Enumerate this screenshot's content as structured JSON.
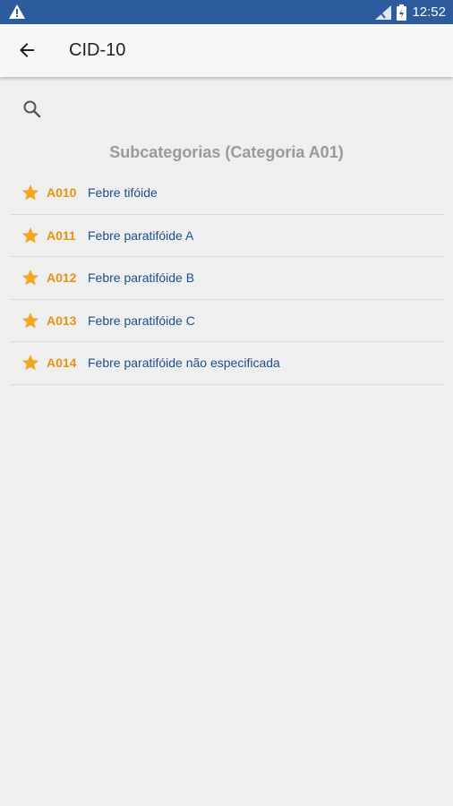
{
  "status_bar": {
    "time": "12:52",
    "icons": [
      "warning-icon",
      "signal-icon",
      "battery-icon"
    ]
  },
  "app_bar": {
    "title": "CID-10",
    "back_icon": "arrow-back-icon"
  },
  "search": {
    "icon": "search-icon"
  },
  "section": {
    "title": "Subcategorias (Categoria A01)"
  },
  "list": {
    "items": [
      {
        "code": "A010",
        "description": "Febre tifóide"
      },
      {
        "code": "A011",
        "description": "Febre paratifóide A"
      },
      {
        "code": "A012",
        "description": "Febre paratifóide B"
      },
      {
        "code": "A013",
        "description": "Febre paratifóide C"
      },
      {
        "code": "A014",
        "description": "Febre paratifóide não especificada"
      }
    ]
  },
  "colors": {
    "status_bar": "#2d5c9e",
    "code": "#e8920f",
    "description": "#1f4e8c",
    "star": "#f4a622",
    "section_title": "#9a9a9a"
  }
}
